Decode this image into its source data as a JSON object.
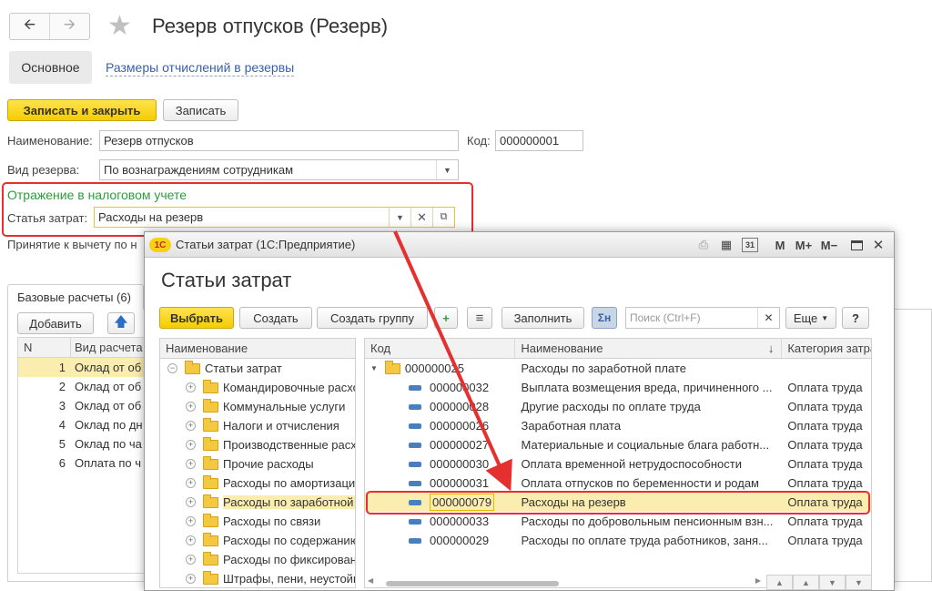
{
  "main": {
    "title": "Резерв отпусков (Резерв)",
    "tabs": {
      "main": "Основное",
      "link": "Размеры отчислений в резервы"
    },
    "buttons": {
      "save_close": "Записать и закрыть",
      "save": "Записать"
    },
    "name_label": "Наименование:",
    "name_value": "Резерв отпусков",
    "code_label": "Код:",
    "code_value": "000000001",
    "reserve_type_label": "Вид резерва:",
    "reserve_type_value": "По вознаграждениям сотрудникам",
    "tax_section": "Отражение в налоговом учете",
    "cost_item_label": "Статья затрат:",
    "cost_item_value": "Расходы на резерв",
    "deduction_label": "Принятие к вычету по н",
    "base_tab": "Базовые расчеты (6)",
    "add_button": "Добавить",
    "grid": {
      "col_n": "N",
      "col_type": "Вид расчета",
      "rows": [
        {
          "n": "1",
          "value": "Оклад от об"
        },
        {
          "n": "2",
          "value": "Оклад от об"
        },
        {
          "n": "3",
          "value": "Оклад от об"
        },
        {
          "n": "4",
          "value": "Оклад по дн"
        },
        {
          "n": "5",
          "value": "Оклад по ча"
        },
        {
          "n": "6",
          "value": "Оплата по ч"
        }
      ]
    }
  },
  "dialog": {
    "window_title": "Статьи затрат  (1С:Предприятие)",
    "logo": "1С",
    "title": "Статьи затрат",
    "toolbar_glyphs": {
      "m": "M",
      "m_plus": "M+",
      "m_minus": "M−",
      "close": "✕",
      "sigma": "Σн",
      "list": "≡",
      "add_group": "+",
      "cal": "31"
    },
    "buttons": {
      "select": "Выбрать",
      "create": "Создать",
      "create_group": "Создать группу",
      "fill": "Заполнить",
      "more": "Еще",
      "help": "?"
    },
    "search_placeholder": "Поиск (Ctrl+F)",
    "tree": {
      "header": "Наименование",
      "root": "Статьи затрат",
      "items": [
        "Командировочные расходы",
        "Коммунальные услуги",
        "Налоги и отчисления",
        "Производственные расходы",
        "Прочие расходы",
        "Расходы по амортизации",
        "Расходы по заработной плате",
        "Расходы по связи",
        "Расходы по содержанию",
        "Расходы по фиксированным",
        "Штрафы, пени, неустойки"
      ]
    },
    "table": {
      "col_code": "Код",
      "col_name": "Наименование",
      "col_category": "Категория затрат",
      "sort_glyph": "↓",
      "group": {
        "code": "000000025",
        "name": "Расходы по заработной плате"
      },
      "rows": [
        {
          "code": "000000032",
          "name": "Выплата возмещения вреда, причиненного ...",
          "category": "Оплата труда"
        },
        {
          "code": "000000028",
          "name": "Другие расходы по оплате труда",
          "category": "Оплата труда"
        },
        {
          "code": "000000026",
          "name": "Заработная плата",
          "category": "Оплата труда"
        },
        {
          "code": "000000027",
          "name": "Материальные и социальные блага работн...",
          "category": "Оплата труда"
        },
        {
          "code": "000000030",
          "name": "Оплата временной нетрудоспособности",
          "category": "Оплата труда"
        },
        {
          "code": "000000031",
          "name": "Оплата отпусков по беременности и родам",
          "category": "Оплата труда"
        },
        {
          "code": "000000079",
          "name": "Расходы на резерв",
          "category": "Оплата труда"
        },
        {
          "code": "000000033",
          "name": "Расходы по добровольным пенсионным взн...",
          "category": "Оплата труда"
        },
        {
          "code": "000000029",
          "name": "Расходы по оплате труда работников, заня...",
          "category": "Оплата труда"
        }
      ]
    }
  },
  "colors": {
    "accent_yellow": "#f6cc00",
    "highlight_red": "#e53030",
    "green": "#2e9d3a",
    "link": "#3a5fa8"
  }
}
